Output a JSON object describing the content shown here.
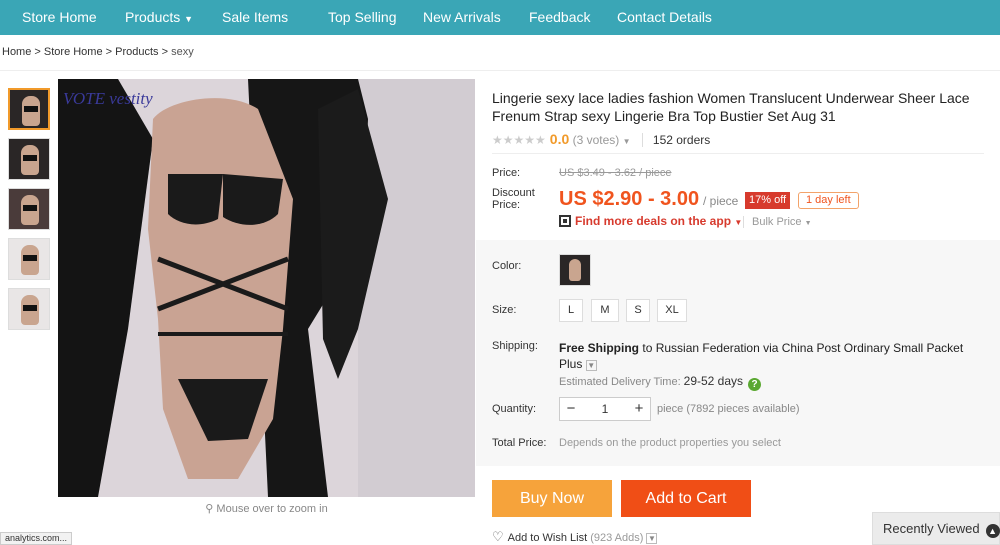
{
  "nav": {
    "items": [
      "Store Home",
      "Products",
      "Sale Items",
      "Top Selling",
      "New Arrivals",
      "Feedback",
      "Contact Details"
    ]
  },
  "breadcrumb": [
    "Home",
    "Store Home",
    "Products",
    "sexy"
  ],
  "gallery": {
    "watermark": "VOTE vestity",
    "zoom_hint": "Mouse over to zoom in"
  },
  "product": {
    "title": "Lingerie sexy lace ladies fashion Women Translucent Underwear Sheer Lace Frenum Strap sexy Lingerie Bra Top Bustier Set Aug 31",
    "rating": "0.0",
    "votes": "(3 votes)",
    "orders": "152 orders",
    "price_label": "Price:",
    "old_price": "US $3.49 - 3.62 / piece",
    "discount_label_1": "Discount",
    "discount_label_2": "Price:",
    "price": "US $2.90 - 3.00",
    "unit": "/ piece",
    "off_badge": "17% off",
    "days_left": "1 day left",
    "deals_link": "Find more deals on the app",
    "bulk_price": "Bulk Price"
  },
  "options": {
    "color_label": "Color:",
    "size_label": "Size:",
    "sizes": [
      "L",
      "M",
      "S",
      "XL"
    ],
    "shipping_label": "Shipping:",
    "shipping_free": "Free Shipping",
    "shipping_rest": "to Russian Federation via China Post Ordinary Small Packet Plus",
    "est_label": "Estimated Delivery Time:",
    "est_days": "29-52 days",
    "quantity_label": "Quantity:",
    "quantity_value": "1",
    "availability": "piece (7892 pieces available)",
    "total_label": "Total Price:",
    "total_value": "Depends on the product properties you select"
  },
  "actions": {
    "buy_now": "Buy Now",
    "add_to_cart": "Add to Cart",
    "wish_list": "Add to Wish List",
    "wish_count": "(923 Adds)"
  },
  "footer": {
    "recently_viewed": "Recently Viewed",
    "status_url": "analytics.com..."
  },
  "colors": {
    "nav_bg": "#3aa6b6",
    "price": "#f0541e",
    "buy_now": "#f6a33b",
    "add_to_cart": "#f04e16",
    "thumb_active": "#f19a2a"
  }
}
